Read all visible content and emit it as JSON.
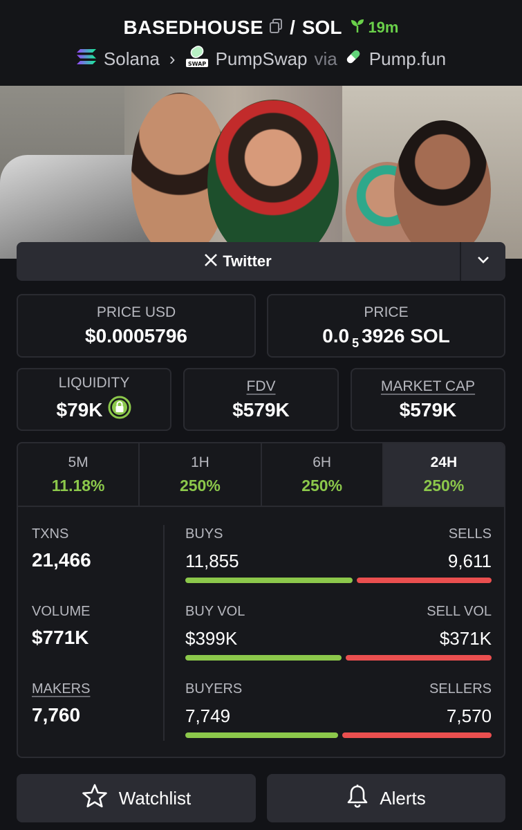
{
  "header": {
    "base_token": "BASEDHOUSE",
    "separator": "/",
    "quote_token": "SOL",
    "age": "19m",
    "chain": "Solana",
    "dex": "PumpSwap",
    "via": "via",
    "launchpad": "Pump.fun",
    "swap_badge": "SWAP"
  },
  "social": {
    "twitter_label": "Twitter"
  },
  "price": {
    "usd_label": "PRICE USD",
    "usd_value": "$0.0005796",
    "native_label": "PRICE",
    "native_prefix": "0.0",
    "native_zeros": "5",
    "native_rest": "3926 SOL"
  },
  "metrics": {
    "liquidity_label": "LIQUIDITY",
    "liquidity_value": "$79K",
    "fdv_label": "FDV",
    "fdv_value": "$579K",
    "mcap_label": "MARKET CAP",
    "mcap_value": "$579K"
  },
  "timeframes": [
    {
      "label": "5M",
      "change": "11.18%"
    },
    {
      "label": "1H",
      "change": "250%"
    },
    {
      "label": "6H",
      "change": "250%"
    },
    {
      "label": "24H",
      "change": "250%"
    }
  ],
  "active_timeframe": "24H",
  "stats": {
    "txns_label": "TXNS",
    "txns_value": "21,466",
    "volume_label": "VOLUME",
    "volume_value": "$771K",
    "makers_label": "MAKERS",
    "makers_value": "7,760",
    "buys_label": "BUYS",
    "buys_value": "11,855",
    "sells_label": "SELLS",
    "sells_value": "9,611",
    "buys_fraction": 0.552,
    "buyvol_label": "BUY VOL",
    "buyvol_value": "$399K",
    "sellvol_label": "SELL VOL",
    "sellvol_value": "$371K",
    "buyvol_fraction": 0.518,
    "buyers_label": "BUYERS",
    "buyers_value": "7,749",
    "sellers_label": "SELLERS",
    "sellers_value": "7,570",
    "buyers_fraction": 0.506
  },
  "actions": {
    "watchlist_label": "Watchlist",
    "alerts_label": "Alerts"
  },
  "colors": {
    "up": "#8cc84b",
    "down": "#ea4f4f",
    "background": "#121317",
    "panel": "#2b2c33"
  }
}
